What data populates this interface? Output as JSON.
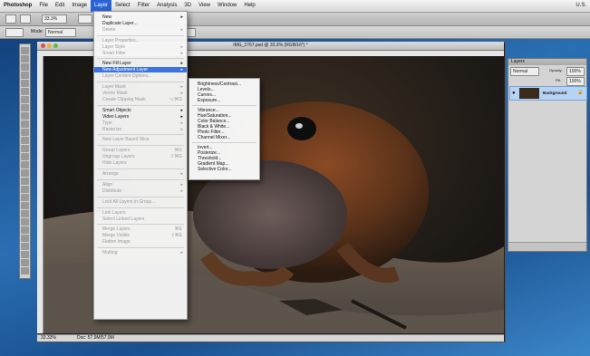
{
  "menubar": {
    "items": [
      "Photoshop",
      "File",
      "Edit",
      "Image",
      "Layer",
      "Select",
      "Filter",
      "Analysis",
      "3D",
      "View",
      "Window",
      "Help"
    ],
    "active": "Layer",
    "right_text": "U.S."
  },
  "appbar": {
    "zoom": "33.3%"
  },
  "optbar": {
    "mode_label": "Mode:",
    "mode_value": "Normal"
  },
  "document": {
    "title": "IMG_2767.psd @ 33.3% (RGB/16*) *",
    "status_zoom": "33.33%",
    "status_doc": "Doc: 57.9M/57.9M"
  },
  "layers_panel": {
    "tab": "Layers",
    "blend": "Normal",
    "opacity_label": "Opacity:",
    "opacity": "100%",
    "fill_label": "Fill:",
    "fill": "100%",
    "layer_name": "Background"
  },
  "layer_menu": [
    {
      "label": "New",
      "enabled": true,
      "arrow": true
    },
    {
      "label": "Duplicate Layer...",
      "enabled": true
    },
    {
      "label": "Delete",
      "enabled": false,
      "arrow": true
    },
    {
      "sep": true
    },
    {
      "label": "Layer Properties...",
      "enabled": false
    },
    {
      "label": "Layer Style",
      "enabled": false,
      "arrow": true
    },
    {
      "label": "Smart Filter",
      "enabled": false,
      "arrow": true
    },
    {
      "sep": true
    },
    {
      "label": "New Fill Layer",
      "enabled": true,
      "arrow": true
    },
    {
      "label": "New Adjustment Layer",
      "enabled": true,
      "arrow": true,
      "highlight": true
    },
    {
      "label": "Layer Content Options...",
      "enabled": false
    },
    {
      "sep": true
    },
    {
      "label": "Layer Mask",
      "enabled": false,
      "arrow": true
    },
    {
      "label": "Vector Mask",
      "enabled": false,
      "arrow": true
    },
    {
      "label": "Create Clipping Mask",
      "enabled": false,
      "shortcut": "⌥⌘G"
    },
    {
      "sep": true
    },
    {
      "label": "Smart Objects",
      "enabled": true,
      "arrow": true
    },
    {
      "label": "Video Layers",
      "enabled": true,
      "arrow": true
    },
    {
      "label": "Type",
      "enabled": false,
      "arrow": true
    },
    {
      "label": "Rasterize",
      "enabled": false,
      "arrow": true
    },
    {
      "sep": true
    },
    {
      "label": "New Layer Based Slice",
      "enabled": false
    },
    {
      "sep": true
    },
    {
      "label": "Group Layers",
      "enabled": false,
      "shortcut": "⌘G"
    },
    {
      "label": "Ungroup Layers",
      "enabled": false,
      "shortcut": "⇧⌘G"
    },
    {
      "label": "Hide Layers",
      "enabled": false
    },
    {
      "sep": true
    },
    {
      "label": "Arrange",
      "enabled": false,
      "arrow": true
    },
    {
      "sep": true
    },
    {
      "label": "Align",
      "enabled": false,
      "arrow": true
    },
    {
      "label": "Distribute",
      "enabled": false,
      "arrow": true
    },
    {
      "sep": true
    },
    {
      "label": "Lock All Layers in Group...",
      "enabled": false
    },
    {
      "sep": true
    },
    {
      "label": "Link Layers",
      "enabled": false
    },
    {
      "label": "Select Linked Layers",
      "enabled": false
    },
    {
      "sep": true
    },
    {
      "label": "Merge Layers",
      "enabled": false,
      "shortcut": "⌘E"
    },
    {
      "label": "Merge Visible",
      "enabled": false,
      "shortcut": "⇧⌘E"
    },
    {
      "label": "Flatten Image",
      "enabled": false
    },
    {
      "sep": true
    },
    {
      "label": "Matting",
      "enabled": false,
      "arrow": true
    }
  ],
  "adjustment_submenu": [
    {
      "label": "Brightness/Contrast..."
    },
    {
      "label": "Levels..."
    },
    {
      "label": "Curves..."
    },
    {
      "label": "Exposure..."
    },
    {
      "sep": true
    },
    {
      "label": "Vibrance..."
    },
    {
      "label": "Hue/Saturation..."
    },
    {
      "label": "Color Balance..."
    },
    {
      "label": "Black & White..."
    },
    {
      "label": "Photo Filter..."
    },
    {
      "label": "Channel Mixer..."
    },
    {
      "sep": true
    },
    {
      "label": "Invert..."
    },
    {
      "label": "Posterize..."
    },
    {
      "label": "Threshold..."
    },
    {
      "label": "Gradient Map..."
    },
    {
      "label": "Selective Color..."
    }
  ],
  "colors": {
    "highlight": "#3b73e0",
    "menubar_active": "#2b63d6",
    "layer_selected": "#b7d3f3"
  }
}
